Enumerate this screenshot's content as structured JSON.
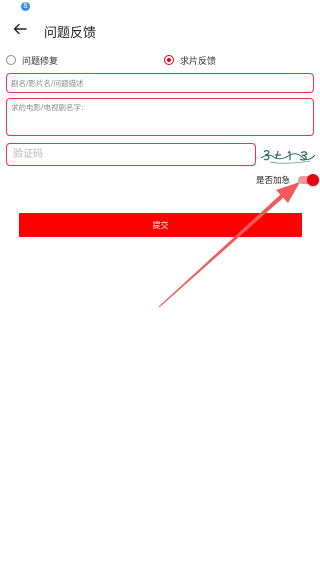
{
  "status_bar": {
    "badge": "ß"
  },
  "header": {
    "title": "问题反馈",
    "back_icon": "back-arrow-icon"
  },
  "feedback_type": {
    "options": [
      {
        "label": "问题修复",
        "selected": false
      },
      {
        "label": "求片反馈",
        "selected": true
      }
    ]
  },
  "form": {
    "title_placeholder": "剧名/影片名/问题描述",
    "detail_placeholder": "求的电影/电视剧名字:",
    "captcha_placeholder": "验证码",
    "urgent_label": "是否加急",
    "urgent_on": true,
    "submit_label": "提交"
  },
  "theme": {
    "accent": "#e60012",
    "field_border": "#e8334a",
    "submit_bg": "#ff0000",
    "annotation": "#f05a5a"
  }
}
